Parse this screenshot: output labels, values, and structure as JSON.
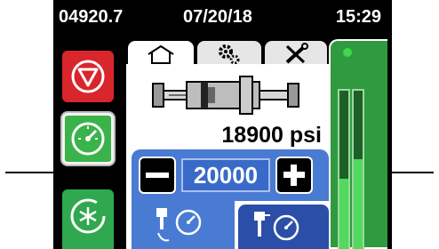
{
  "status_bar": {
    "serial": "04920.7",
    "date": "07/20/18",
    "time": "15:29"
  },
  "sidebar": {
    "items": [
      {
        "name": "stop",
        "icon": "stop-icon",
        "color": "#d8262c"
      },
      {
        "name": "run",
        "icon": "gauge-icon",
        "color": "#3ab34a",
        "selected": true
      },
      {
        "name": "defrost",
        "icon": "snowflake-cycle-icon",
        "color": "#2fa84f"
      }
    ]
  },
  "tabs": [
    {
      "name": "home",
      "icon": "home-icon",
      "active": true
    },
    {
      "name": "settings",
      "icon": "gears-icon",
      "active": false
    },
    {
      "name": "tools",
      "icon": "tools-icon",
      "active": false
    }
  ],
  "main": {
    "pressure_readout": "18900 psi",
    "setpoint_value": "20000",
    "accent_color": "#4a7bd3"
  },
  "gauges": {
    "left_level": 0.45,
    "right_level": 0.57,
    "fill_color": "#52d95e"
  }
}
